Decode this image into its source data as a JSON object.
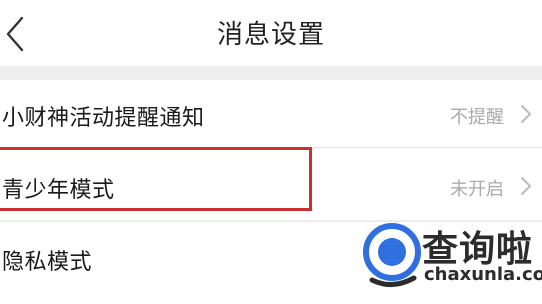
{
  "header": {
    "title": "消息设置",
    "back_icon": "chevron-left-icon"
  },
  "settings": [
    {
      "label": "小财神活动提醒通知",
      "value": "不提醒"
    },
    {
      "label": "青少年模式",
      "value": "未开启"
    },
    {
      "label": "隐私模式",
      "value": ""
    }
  ],
  "watermark": {
    "brand": "查询啦",
    "url": "chaxunla.com",
    "icon": "q-logo-icon"
  },
  "colors": {
    "highlight": "#c8312f",
    "logo_blue": "#2f6fe0",
    "value_gray": "#aaaaaa"
  }
}
